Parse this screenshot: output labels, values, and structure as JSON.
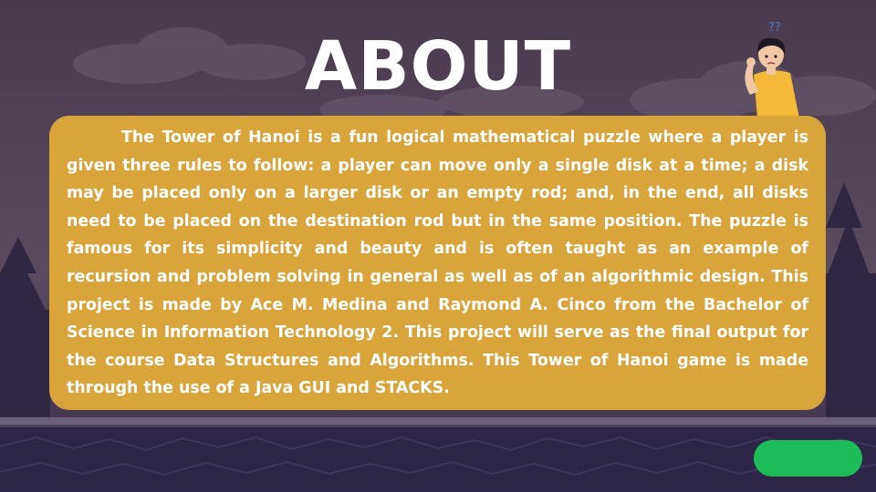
{
  "page": {
    "title": "ABOUT",
    "body": "The Tower of Hanoi is a fun logical mathematical puzzle where a player is given three rules to follow: a player can move only a single disk at a time; a disk may be placed only on a larger disk or an empty rod; and, in the end, all disks need to be placed on the destination rod but in the same position. The puzzle is famous for its simplicity and beauty and is often taught as an example of recursion and problem solving in general as well as of an algorithmic design. This project is made by Ace M. Medina and Raymond A. Cinco from the Bachelor of Science in Information Technology 2. This project will serve as the final output for the course Data Structures and Algorithms. This Tower of Hanoi game is made through the use of a Java GUI and STACKS."
  },
  "character": {
    "thought": "??"
  },
  "colors": {
    "sky": "#4b3a4f",
    "panel": "#d9a43a",
    "ground": "#2d2648",
    "button": "#1ebc58"
  },
  "icons": {
    "character": "confused-kid-illustration",
    "next": "green-pill-button"
  }
}
